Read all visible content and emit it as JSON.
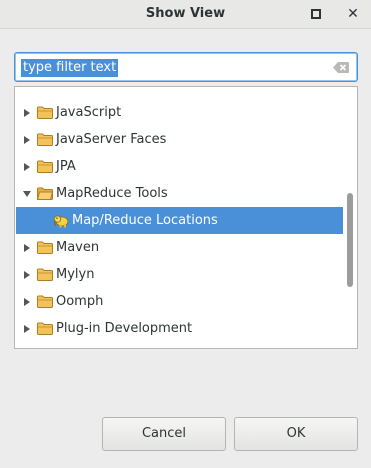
{
  "window": {
    "title": "Show View"
  },
  "filter": {
    "value": "type filter text"
  },
  "tree": {
    "items": [
      {
        "label": "JavaScript",
        "expanded": false,
        "selected": false
      },
      {
        "label": "JavaServer Faces",
        "expanded": false,
        "selected": false
      },
      {
        "label": "JPA",
        "expanded": false,
        "selected": false
      },
      {
        "label": "MapReduce Tools",
        "expanded": true,
        "selected": false
      },
      {
        "label": "Map/Reduce Locations",
        "child": true,
        "selected": true,
        "icon": "elephant-icon"
      },
      {
        "label": "Maven",
        "expanded": false,
        "selected": false
      },
      {
        "label": "Mylyn",
        "expanded": false,
        "selected": false
      },
      {
        "label": "Oomph",
        "expanded": false,
        "selected": false
      },
      {
        "label": "Plug-in Development",
        "expanded": false,
        "selected": false
      }
    ]
  },
  "buttons": {
    "cancel": "Cancel",
    "ok": "OK"
  },
  "colors": {
    "selection": "#4a90d9",
    "folder": "#e8b34a",
    "background": "#ececec"
  }
}
